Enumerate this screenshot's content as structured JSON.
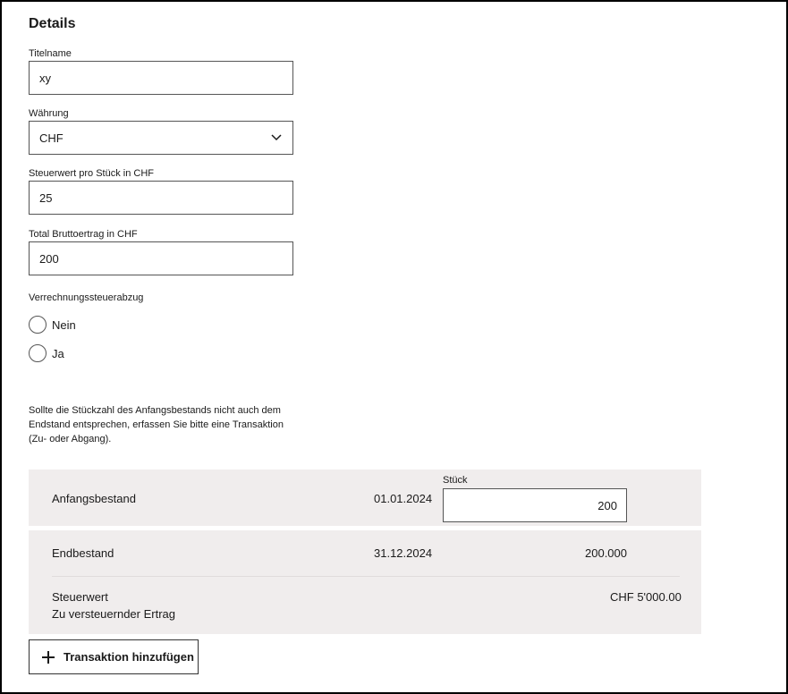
{
  "details": {
    "title": "Details",
    "titlename": {
      "label": "Titelname",
      "value": "xy"
    },
    "currency": {
      "label": "Währung",
      "value": "CHF"
    },
    "tax_value": {
      "label": "Steuerwert pro Stück in CHF",
      "value": "25"
    },
    "gross_income": {
      "label": "Total Bruttoertrag in CHF",
      "value": "200"
    },
    "withholding": {
      "label": "Verrechnungssteuerabzug",
      "options": [
        "Nein",
        "Ja"
      ]
    },
    "info_text": "Sollte die Stückzahl des Anfangsbestands nicht auch dem Endstand entsprechen, erfassen Sie bitte eine Transaktion (Zu- oder Abgang)."
  },
  "opening": {
    "label": "Anfangsbestand",
    "date": "01.01.2024",
    "qty_label": "Stück",
    "qty_value": "200"
  },
  "closing": {
    "label": "Endbestand",
    "date": "31.12.2024",
    "qty": "200.000",
    "tax_value_label": "Steuerwert",
    "taxable_income_label": "Zu versteuernder Ertrag",
    "tax_value_amount": "CHF 5'000.00"
  },
  "actions": {
    "add_transaction": "Transaktion hinzufügen"
  }
}
